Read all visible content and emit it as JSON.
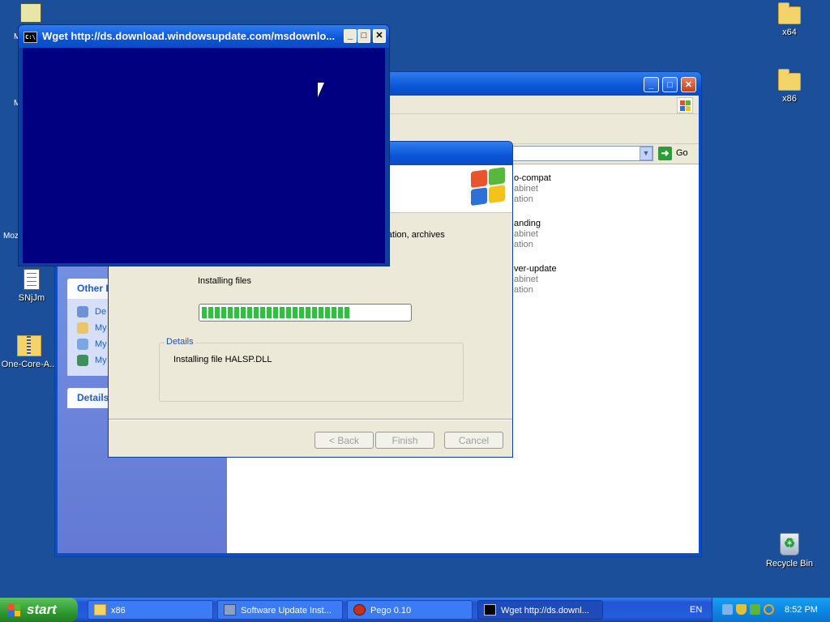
{
  "desktop": {
    "icons": [
      {
        "label": "x64"
      },
      {
        "label": "x86"
      },
      {
        "label": "SNjJm"
      },
      {
        "label": "One-Core-A..."
      },
      {
        "label": "Recycle Bin"
      }
    ],
    "partial_labels": [
      "M",
      "M",
      "Moz"
    ]
  },
  "explorer": {
    "address_go": "Go",
    "panels": {
      "other_title": "Other I",
      "other_items": [
        "De",
        "My",
        "My",
        "My"
      ],
      "details_title": "Details"
    },
    "files": [
      {
        "name": "o-compat",
        "type": "abinet",
        "extra": "ation"
      },
      {
        "name": "anding",
        "type": "abinet",
        "extra": "ation"
      },
      {
        "name": "ver-update",
        "type": "abinet",
        "extra": "ation"
      }
    ]
  },
  "installer": {
    "partial_description": "uration, archives",
    "status": "Installing files",
    "progress_fraction": 0.72,
    "details_label": "Details",
    "details_text": "Installing file HALSP.DLL",
    "buttons": {
      "back": "< Back",
      "finish": "Finish",
      "cancel": "Cancel"
    }
  },
  "wget": {
    "title": "Wget http://ds.download.windowsupdate.com/msdownlo...",
    "icon_text": "C:\\"
  },
  "taskbar": {
    "start_label": "start",
    "buttons": [
      {
        "label": "x86"
      },
      {
        "label": "Software Update Inst..."
      },
      {
        "label": "Pego 0.10"
      },
      {
        "label": "Wget http://ds.downl..."
      }
    ],
    "language": "EN",
    "clock": "8:52 PM"
  },
  "colors": {
    "desktop_bg": "#1c4f9a",
    "console_bg": "#000080",
    "progress_fill": "#27c43c"
  }
}
